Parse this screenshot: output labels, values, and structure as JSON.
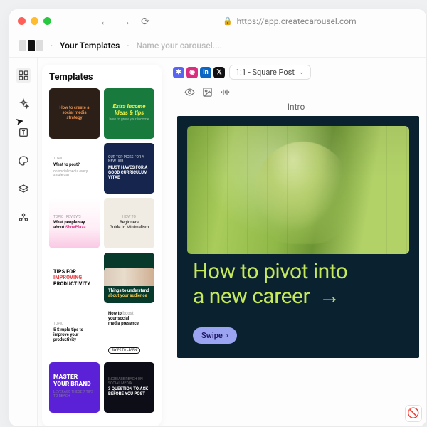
{
  "browser": {
    "url": "https://app.createcarousel.com"
  },
  "crumb": {
    "root": "Your Templates",
    "placeholder": "Name your carousel...."
  },
  "panel": {
    "title": "Templates",
    "templates": [
      {
        "line1": "How to create a",
        "line2": "social media",
        "line3": "strategy",
        "bg": "#2b1f17",
        "accent": "#e08a4a",
        "style": "centered"
      },
      {
        "line1": "Extra Income",
        "line2": "Ideas & tips",
        "sub": "how to grow your income",
        "bg": "#187a3d",
        "accent": "#d9e84a",
        "style": "bold-italic"
      },
      {
        "pre": "topic",
        "line1": "What to post?",
        "sub": "on social media every single day",
        "bg": "#ffffff",
        "fg": "#111",
        "style": "left"
      },
      {
        "pre": "OUR TOP PICKS FOR A NEW JOB",
        "line1": "MUST HAVES FOR A",
        "line2": "GOOD CURRICULUM",
        "line3": "VITAE",
        "bg": "#15254d",
        "accent": "#ffffff",
        "style": "left-small"
      },
      {
        "pre": "topic · reviews",
        "line1": "What people say",
        "line2": "about ShoePlaza",
        "bg": "linear-gradient(180deg,#fff,#ffeef7 60%,#f9c8e3)",
        "fg": "#111",
        "accentWord": "ShoePlaza",
        "accentColor": "#d63384",
        "style": "left"
      },
      {
        "pre": "HOW TO",
        "line1": "Beginners",
        "line2": "Guide to Minimalism",
        "bg": "#f1ece3",
        "fg": "#3a3a3a",
        "style": "center-light"
      },
      {
        "line1": "TIPS FOR",
        "line2": "IMPROVING",
        "line3": "PRODUCTIVITY",
        "bg": "#ffffff",
        "fg": "#111",
        "accentLine": "IMPROVING",
        "accentColor": "#e5484d",
        "style": "tight-caps"
      },
      {
        "line1": "Things to understand",
        "line2": "about your audience",
        "bg": "#083a2b",
        "fg": "#fff",
        "accentLine": "about your audience",
        "accentColor": "#f0c34b",
        "imgStrip": true,
        "style": "bottom"
      },
      {
        "pre": "topic",
        "line1": "5 Simple tips to",
        "line2": "improve your",
        "line3": "productivity",
        "bg": "#ffffff",
        "fg": "#111",
        "accentColor": "#2aa06a",
        "style": "left"
      },
      {
        "line1": "How to boost",
        "line2": "your social",
        "line3": "media presence",
        "bg": "#ffffff",
        "fg": "#111",
        "faded": "boost",
        "cta": "SWIPE TO LEARN",
        "style": "left"
      },
      {
        "line1": "MASTER",
        "line2": "YOUR BRAND",
        "sub": "LEVERAGE THESE 7 TIPS TO REACH",
        "bg": "#5b21d6",
        "fg": "#fff",
        "style": "big-caps"
      },
      {
        "pre": "INCREASE REACH ON SOCIAL MEDIA",
        "line1": "3 QUESTION TO ASK",
        "line2": "BEFORE YOU POST",
        "bg": "#0d0d18",
        "fg": "#fff",
        "accentColor": "#f0c34b",
        "style": "left-small"
      }
    ]
  },
  "canvas": {
    "format_label": "1:1 - Square Post",
    "slide_label": "Intro",
    "headline_l1": "How to pivot into",
    "headline_l2": "a new career",
    "swipe": "Swipe"
  },
  "social": [
    {
      "bg": "#5865f2",
      "glyph": "✱"
    },
    {
      "bg": "#d92e7f",
      "glyph": "◉"
    },
    {
      "bg": "#0a66c2",
      "glyph": "in"
    },
    {
      "bg": "#111111",
      "glyph": "𝕏"
    }
  ]
}
